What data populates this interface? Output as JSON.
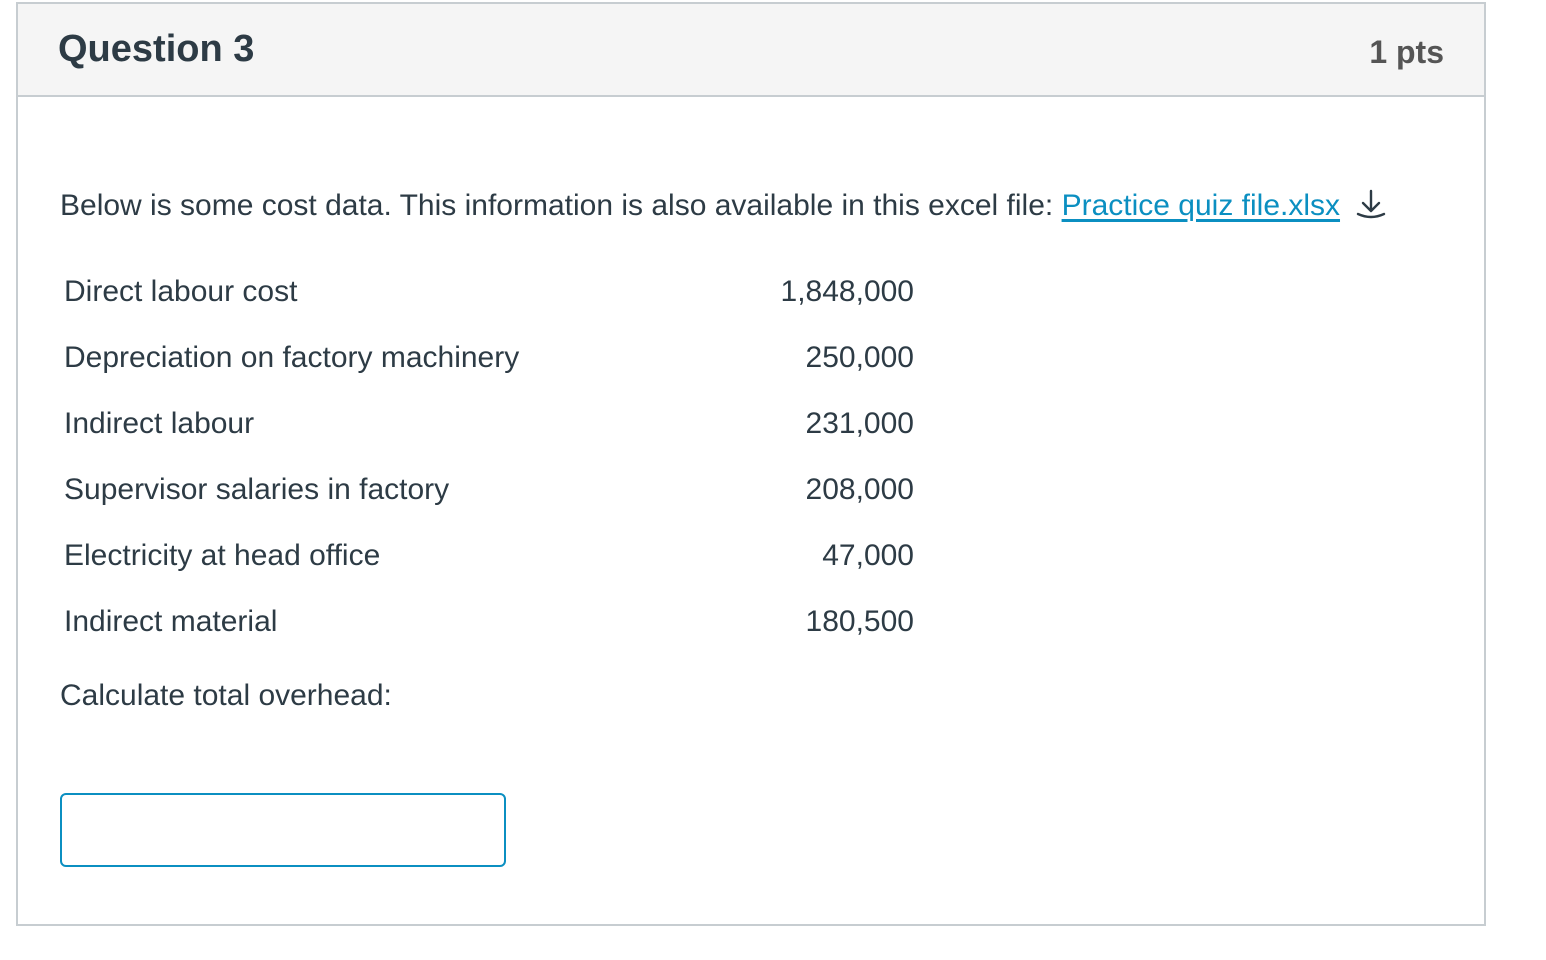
{
  "question": {
    "title": "Question 3",
    "points": "1 pts",
    "intro_text": "Below is some cost data. This information is also available in this excel file: ",
    "file_link_text": "Practice quiz file.xlsx",
    "download_icon": "download-icon",
    "cost_items": [
      {
        "label": "Direct labour cost",
        "value": "1,848,000"
      },
      {
        "label": "Depreciation on factory machinery",
        "value": "250,000"
      },
      {
        "label": "Indirect labour",
        "value": "231,000"
      },
      {
        "label": "Supervisor salaries in factory",
        "value": "208,000"
      },
      {
        "label": "Electricity at head office",
        "value": "47,000"
      },
      {
        "label": "Indirect material",
        "value": "180,500"
      }
    ],
    "prompt": "Calculate total overhead:",
    "answer_value": ""
  },
  "colors": {
    "link": "#0b8fc1",
    "header_bg": "#f5f5f5",
    "border": "#c7cdd1",
    "text": "#2d3b45"
  }
}
